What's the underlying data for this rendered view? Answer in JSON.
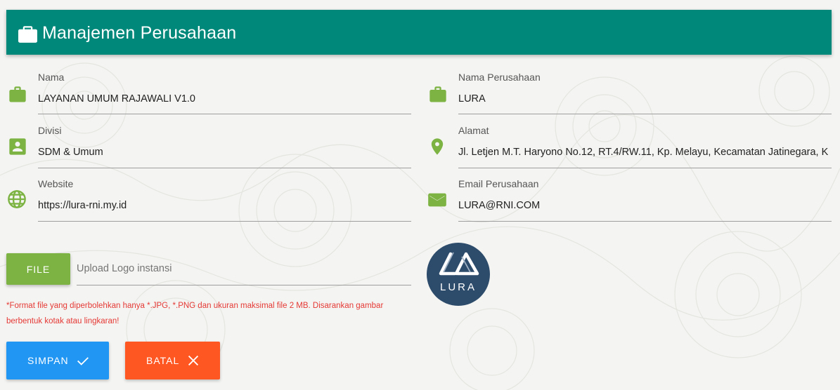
{
  "header": {
    "title": "Manajemen Perusahaan",
    "icon": "briefcase-icon"
  },
  "form": {
    "nama": {
      "label": "Nama",
      "value": "LAYANAN UMUM RAJAWALI V1.0",
      "icon": "briefcase-icon"
    },
    "divisi": {
      "label": "Divisi",
      "value": "SDM & Umum",
      "icon": "contact-card-icon"
    },
    "website": {
      "label": "Website",
      "value": "https://lura-rni.my.id",
      "icon": "globe-icon"
    },
    "nama_perusahaan": {
      "label": "Nama Perusahaan",
      "value": "LURA",
      "icon": "briefcase-icon"
    },
    "alamat": {
      "label": "Alamat",
      "value": "Jl. Letjen M.T. Haryono No.12, RT.4/RW.11, Kp. Melayu, Kecamatan Jatinegara, K",
      "icon": "location-pin-icon"
    },
    "email": {
      "label": "Email Perusahaan",
      "value": "LURA@RNI.COM",
      "icon": "mail-icon"
    }
  },
  "upload": {
    "button_label": "FILE",
    "placeholder": "Upload Logo instansi",
    "note": "*Format file yang diperbolehkan hanya *.JPG, *.PNG dan ukuran maksimal file 2 MB. Disarankan gambar berbentuk kotak atau lingkaran!"
  },
  "logo": {
    "text": "LURA"
  },
  "actions": {
    "save_label": "SIMPAN",
    "save_icon": "check-icon",
    "cancel_label": "BATAL",
    "cancel_icon": "close-icon"
  },
  "colors": {
    "header": "#00897b",
    "field_icon": "#7cb342",
    "file_button": "#7cb342",
    "save_button": "#2196f3",
    "cancel_button": "#ff5722",
    "note_text": "#e53935",
    "logo_bg": "#2d4b6b"
  }
}
